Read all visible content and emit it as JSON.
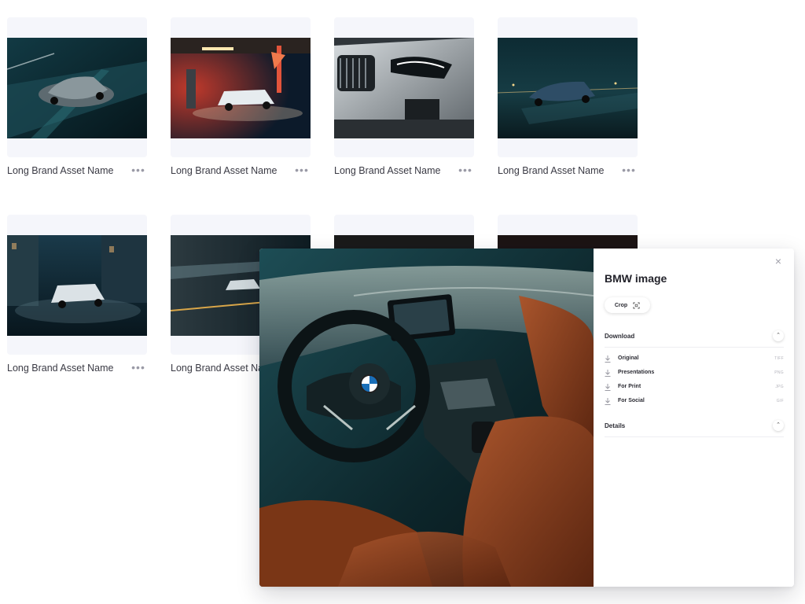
{
  "assets": [
    {
      "name": "Long Brand Asset Name",
      "more": "•••",
      "scene": "night-road"
    },
    {
      "name": "Long Brand Asset Name",
      "more": "•••",
      "scene": "gas-station"
    },
    {
      "name": "Long Brand Asset Name",
      "more": "•••",
      "scene": "front-close"
    },
    {
      "name": "Long Brand Asset Name",
      "more": "•••",
      "scene": "night-coupe"
    },
    {
      "name": "Long Brand Asset Name",
      "more": "•••",
      "scene": "city-street"
    },
    {
      "name": "Long Brand Asset Name",
      "more": "•••",
      "scene": "motion-blur"
    }
  ],
  "preview": {
    "title": "BMW image",
    "close_icon": "×",
    "crop_label": "Crop",
    "download": {
      "label": "Download",
      "chevron": "⌃",
      "items": [
        {
          "label": "Original",
          "ext": "TIFF"
        },
        {
          "label": "Presentations",
          "ext": "PNG"
        },
        {
          "label": "For Print",
          "ext": "JPG"
        },
        {
          "label": "For Social",
          "ext": "GIF"
        }
      ]
    },
    "details": {
      "label": "Details",
      "chevron": "⌃"
    }
  },
  "colors": {
    "card_bg": "#f5f6fb",
    "accent_leather": "#8a3f1e",
    "dark_teal": "#0f2a30"
  }
}
